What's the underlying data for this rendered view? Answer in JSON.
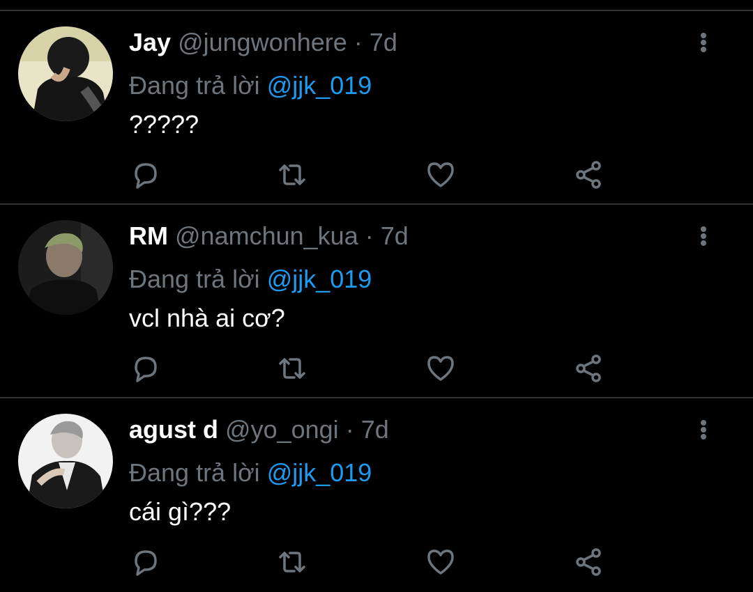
{
  "colors": {
    "background": "#000000",
    "divider": "#2f3336",
    "secondary_text": "#6e767d",
    "mention": "#1d9bf0",
    "primary_text": "#ffffff"
  },
  "reply_prefix": "Đang trả lời",
  "separator": "·",
  "tweets": [
    {
      "name": "Jay",
      "handle": "@jungwonhere",
      "time": "7d",
      "reply_to": "@jjk_019",
      "text": "?????"
    },
    {
      "name": "RM",
      "handle": "@namchun_kua",
      "time": "7d",
      "reply_to": "@jjk_019",
      "text": "vcl nhà ai cơ?"
    },
    {
      "name": "agust d",
      "handle": "@yo_ongi",
      "time": "7d",
      "reply_to": "@jjk_019",
      "text": "cái gì???"
    }
  ],
  "icons": {
    "more": "more-vertical-icon",
    "reply": "reply-icon",
    "retweet": "retweet-icon",
    "like": "heart-icon",
    "share": "share-icon"
  }
}
